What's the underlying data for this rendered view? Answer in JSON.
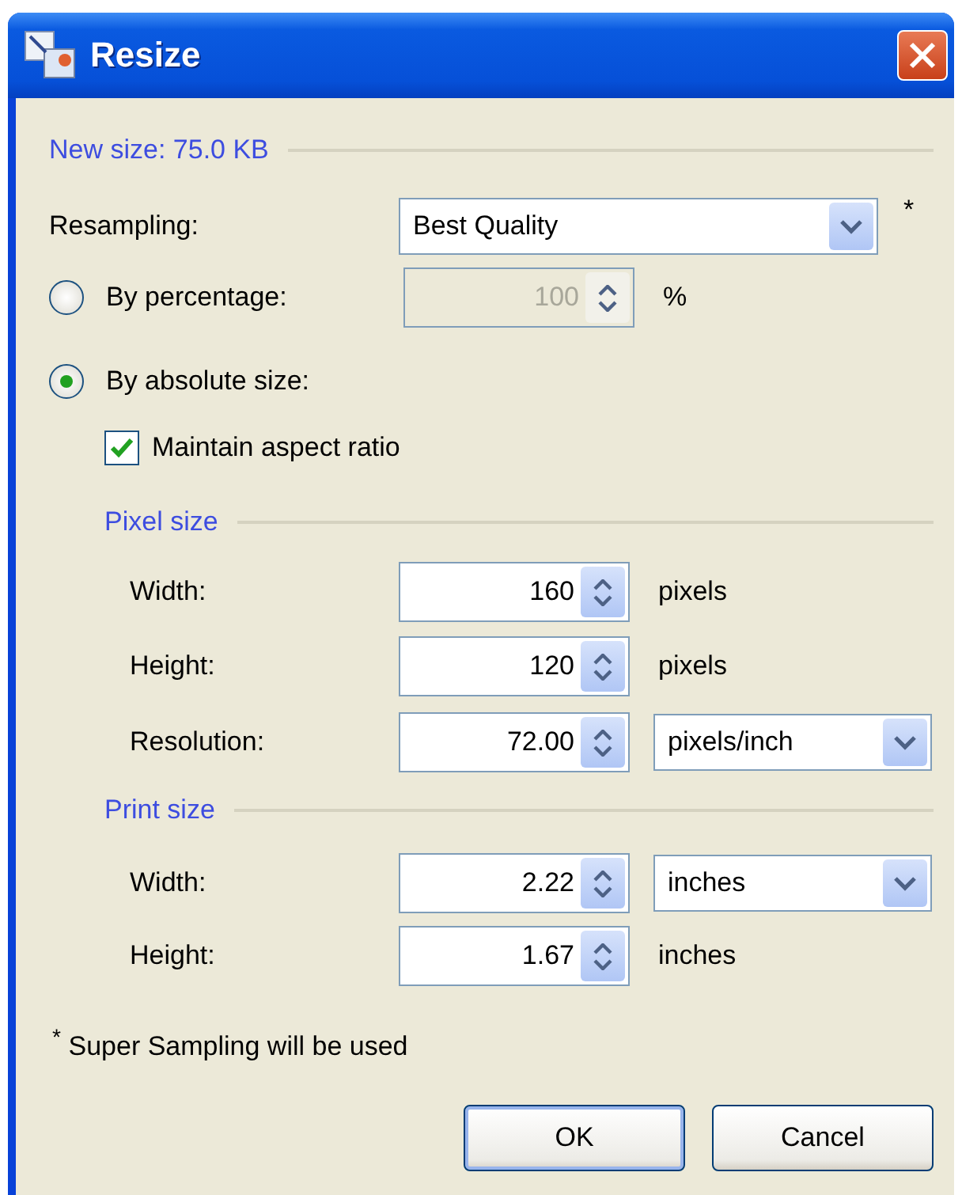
{
  "window": {
    "title": "Resize"
  },
  "new_size": "New size: 75.0 KB",
  "resampling": {
    "label": "Resampling:",
    "value": "Best Quality",
    "note_mark": "*"
  },
  "by_percentage": {
    "label": "By percentage:",
    "selected": false,
    "value": "100",
    "disabled": true,
    "unit": "%"
  },
  "by_absolute": {
    "label": "By absolute size:",
    "selected": true
  },
  "maintain_aspect": {
    "label": "Maintain aspect ratio",
    "checked": true
  },
  "pixel_size": {
    "title": "Pixel size",
    "rows": [
      {
        "label": "Width:",
        "value": "160",
        "unit": "pixels",
        "kind": "text"
      },
      {
        "label": "Height:",
        "value": "120",
        "unit": "pixels",
        "kind": "text"
      },
      {
        "label": "Resolution:",
        "value": "72.00",
        "unit": "pixels/inch",
        "kind": "dropdown"
      }
    ]
  },
  "print_size": {
    "title": "Print size",
    "rows": [
      {
        "label": "Width:",
        "value": "2.22",
        "unit": "inches",
        "kind": "dropdown"
      },
      {
        "label": "Height:",
        "value": "1.67",
        "unit": "inches",
        "kind": "text"
      }
    ]
  },
  "footnote": "$^{*}$ Super Sampling will be used",
  "buttons": [
    {
      "label": "OK",
      "default": true
    },
    {
      "label": "Cancel",
      "default": false
    }
  ]
}
